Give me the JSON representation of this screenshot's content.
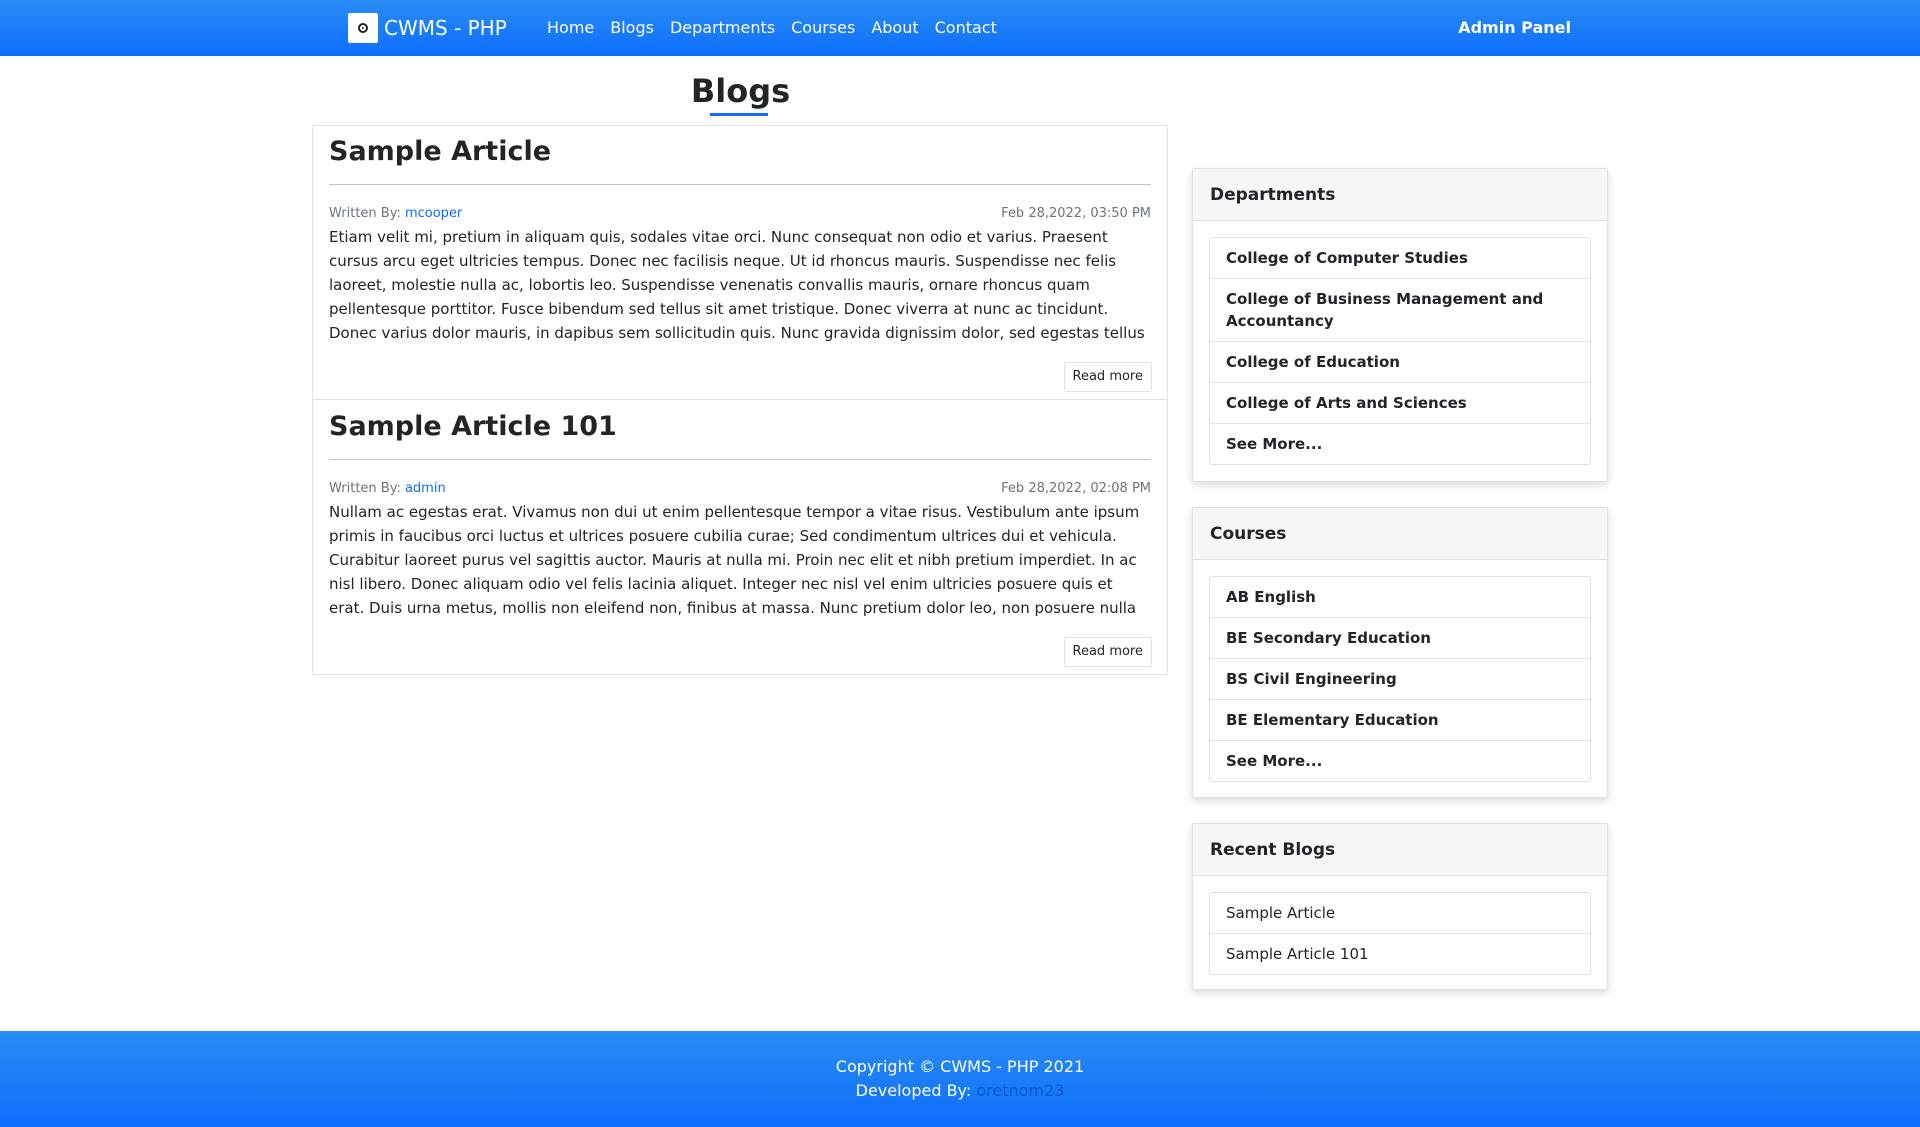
{
  "navbar": {
    "brand": "CWMS - PHP",
    "links": [
      "Home",
      "Blogs",
      "Departments",
      "Courses",
      "About",
      "Contact"
    ],
    "admin": "Admin Panel"
  },
  "page": {
    "title": "Blogs"
  },
  "blogs": [
    {
      "title": "Sample Article",
      "written_by_label": "Written By: ",
      "author": "mcooper",
      "date": "Feb 28,2022, 03:50 PM",
      "excerpt": "Etiam velit mi, pretium in aliquam quis, sodales vitae orci. Nunc consequat non odio et varius. Praesent cursus arcu eget ultricies tempus. Donec nec facilisis neque. Ut id rhoncus mauris. Suspendisse nec felis laoreet, molestie nulla ac, lobortis leo. Suspendisse venenatis convallis mauris, ornare rhoncus quam pellentesque porttitor. Fusce bibendum sed tellus sit amet tristique. Donec viverra at nunc ac tincidunt. Donec varius dolor mauris, in dapibus sem sollicitudin quis. Nunc gravida dignissim dolor, sed egestas tellus tempus non. Praesent eget nisi dignissim, ornare...",
      "read_more": "Read more"
    },
    {
      "title": "Sample Article 101",
      "written_by_label": "Written By: ",
      "author": "admin",
      "date": "Feb 28,2022, 02:08 PM",
      "excerpt": "Nullam ac egestas erat. Vivamus non dui ut enim pellentesque tempor a vitae risus. Vestibulum ante ipsum primis in faucibus orci luctus et ultrices posuere cubilia curae; Sed condimentum ultrices dui et vehicula. Curabitur laoreet purus vel sagittis auctor. Mauris at nulla mi. Proin nec elit et nibh pretium imperdiet. In ac nisl libero. Donec aliquam odio vel felis lacinia aliquet. Integer nec nisl vel enim ultricies posuere quis et erat. Duis urna metus, mollis non eleifend non, finibus at massa. Nunc pretium dolor leo, non posuere nulla scelerisque ut. Donec eleifend consectet...",
      "read_more": "Read more"
    }
  ],
  "sidebar": {
    "departments": {
      "header": "Departments",
      "items": [
        "College of Computer Studies",
        "College of Business Management and Accountancy",
        "College of Education",
        "College of Arts and Sciences",
        "See More..."
      ]
    },
    "courses": {
      "header": "Courses",
      "items": [
        "AB English",
        "BE Secondary Education",
        "BS Civil Engineering",
        "BE Elementary Education",
        "See More..."
      ]
    },
    "recent_blogs": {
      "header": "Recent Blogs",
      "items": [
        "Sample Article",
        "Sample Article 101"
      ]
    }
  },
  "footer": {
    "copyright": "Copyright © CWMS - PHP 2021",
    "developed_by_label": "Developed By: ",
    "developer": "oretnom23"
  },
  "colors": {
    "primary": "#0d6efd",
    "navbar_top": "#2a8cf4"
  }
}
